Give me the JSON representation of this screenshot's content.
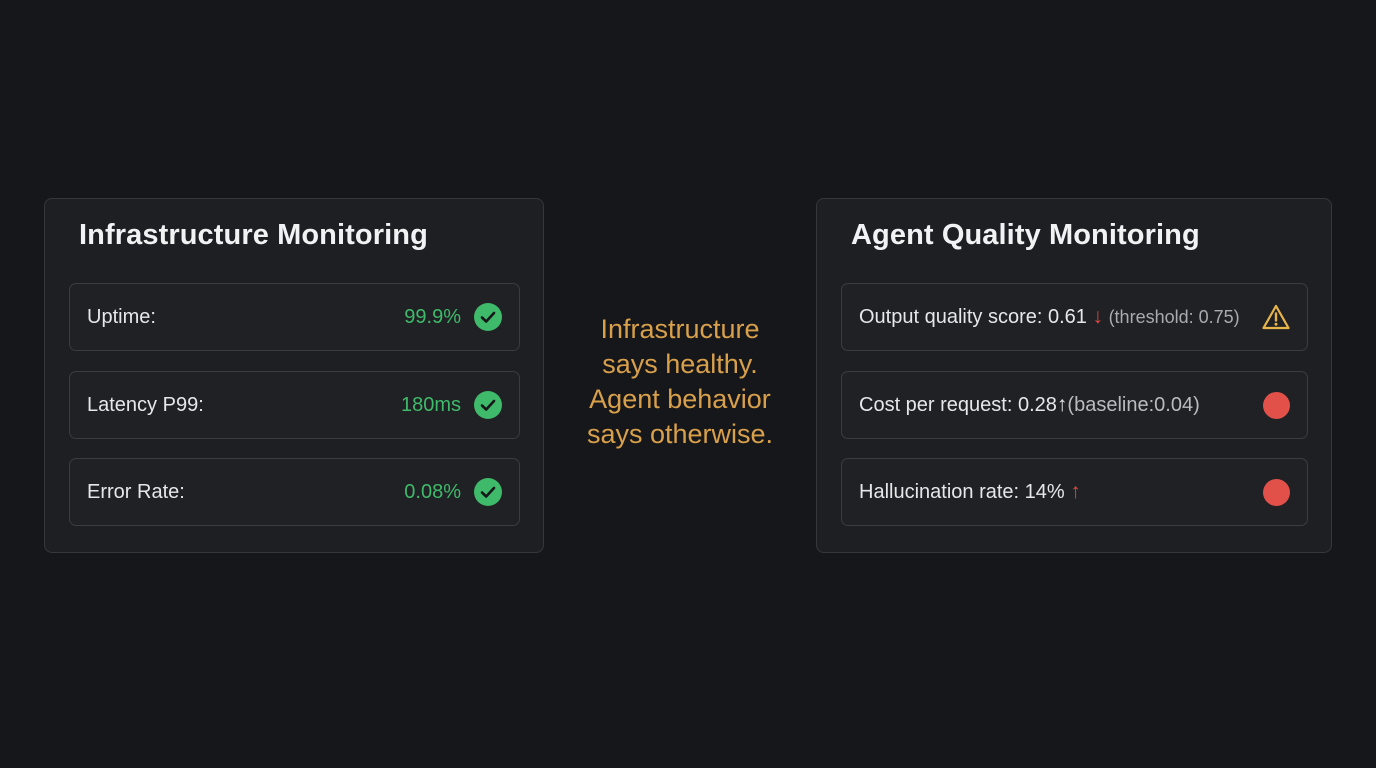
{
  "infrastructure": {
    "title": "Infrastructure Monitoring",
    "rows": [
      {
        "label": "Uptime:",
        "value": "99.9%",
        "status_icon": "check-circle-icon"
      },
      {
        "label": "Latency P99:",
        "value": "180ms",
        "status_icon": "check-circle-icon"
      },
      {
        "label": "Error Rate:",
        "value": "0.08%",
        "status_icon": "check-circle-icon"
      }
    ],
    "status_color": "#3fb96a"
  },
  "callout": {
    "lines": [
      "Infrastructure",
      "says healthy.",
      "Agent behavior",
      "says otherwise."
    ],
    "color": "#d8a04b"
  },
  "agent_quality": {
    "title": "Agent Quality Monitoring",
    "output_quality": {
      "label": "Output quality score:",
      "value": "0.61",
      "trend_arrow": "↓",
      "reference": "(threshold: 0.75)",
      "status_icon": "warning-triangle-icon"
    },
    "cost_per_request": {
      "label": "Cost per request:",
      "value": "0.28",
      "trend_arrow": "↑",
      "reference": "(baseline:0.04)",
      "status_icon": "red-status-dot"
    },
    "hallucination": {
      "label": "Hallucination rate:",
      "value": "14%",
      "trend_arrow": "↑",
      "status_icon": "red-status-dot"
    },
    "alert_color": "#e2504a",
    "warning_color": "#e8b54a"
  }
}
